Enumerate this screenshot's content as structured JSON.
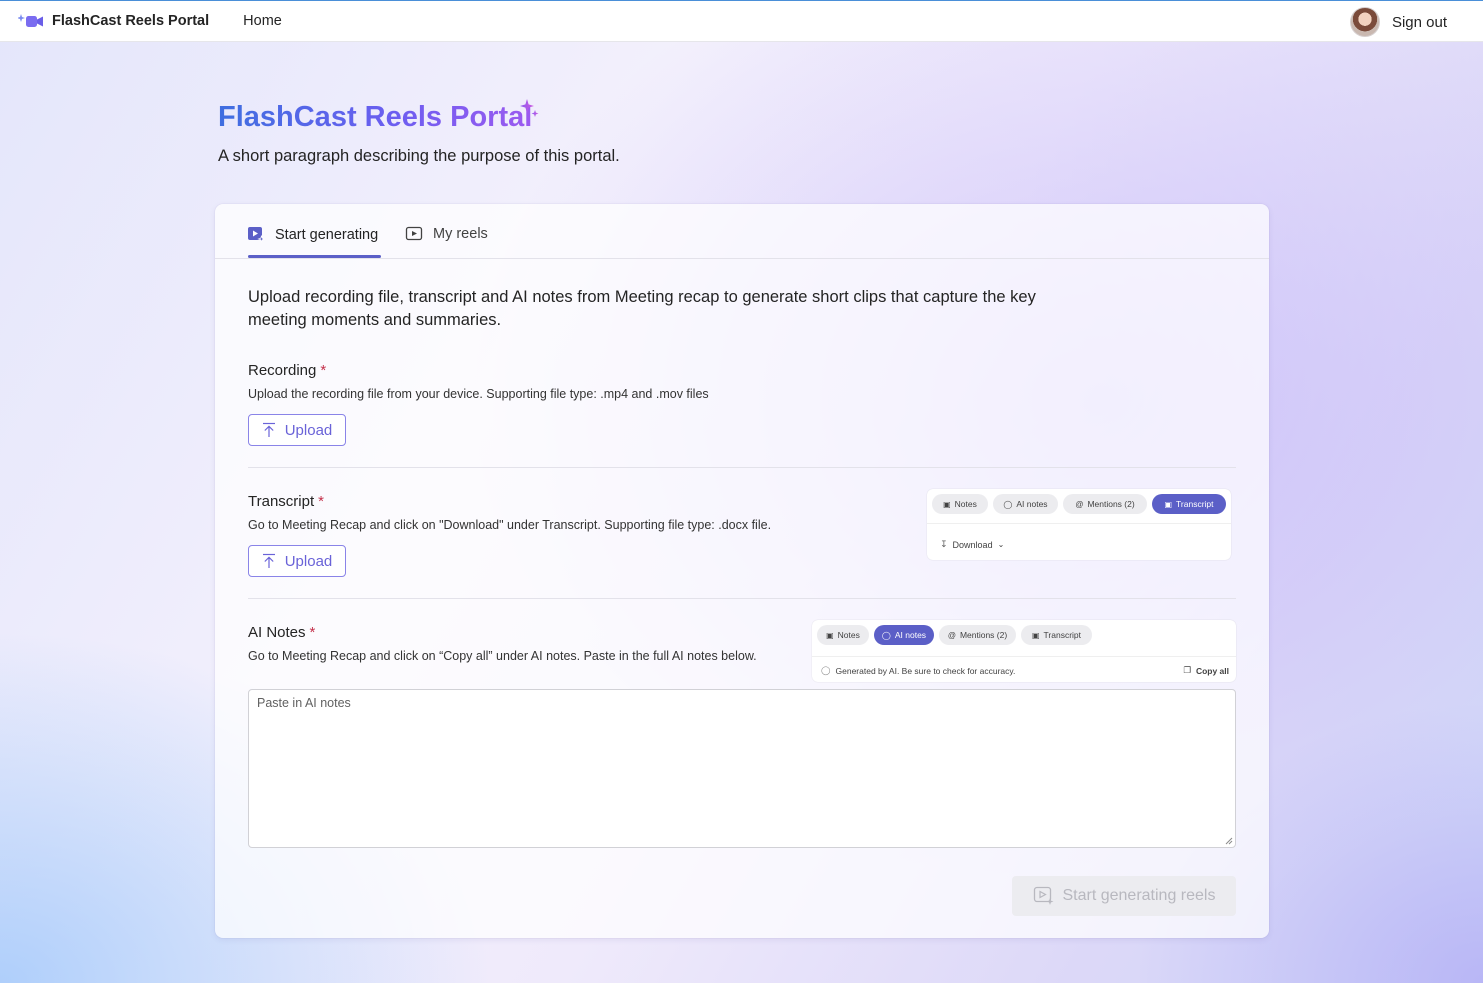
{
  "app": {
    "name": "FlashCast Reels Portal",
    "nav_home": "Home",
    "sign_out": "Sign out"
  },
  "hero": {
    "title": "FlashCast Reels Portal",
    "description": "A short paragraph describing the purpose of this portal."
  },
  "tabs": [
    {
      "label": "Start generating",
      "active": true,
      "icon": "video-sparkle-icon"
    },
    {
      "label": "My reels",
      "active": false,
      "icon": "video-play-icon"
    }
  ],
  "intro": "Upload recording file, transcript and AI notes from Meeting recap to generate short clips that capture the key meeting moments and summaries.",
  "sections": {
    "recording": {
      "label": "Recording",
      "required": "*",
      "help": "Upload the recording file from your device. Supporting file type: .mp4 and .mov files",
      "button": "Upload"
    },
    "transcript": {
      "label": "Transcript",
      "required": "*",
      "help": "Go to Meeting Recap and click on \"Download\" under Transcript. Supporting file type: .docx file.",
      "button": "Upload",
      "preview": {
        "pills": [
          "Notes",
          "AI notes",
          "Mentions (2)",
          "Transcript"
        ],
        "active": "Transcript",
        "download": "Download"
      }
    },
    "ai_notes": {
      "label": "AI Notes",
      "required": "*",
      "help": "Go to Meeting Recap and click on “Copy all” under AI notes. Paste in the full AI notes below.",
      "placeholder": "Paste in AI notes",
      "preview": {
        "pills": [
          "Notes",
          "AI notes",
          "Mentions (2)",
          "Transcript"
        ],
        "active": "AI notes",
        "disclaimer": "Generated by AI. Be sure to check for accuracy.",
        "copy_all": "Copy all"
      }
    }
  },
  "generate_button": "Start generating reels",
  "colors": {
    "accent": "#5b5fc7",
    "upload_border": "#8a84e8",
    "required": "#c4314b",
    "title_gradient_start": "#3f6fe0",
    "title_gradient_end": "#9c5af0"
  }
}
